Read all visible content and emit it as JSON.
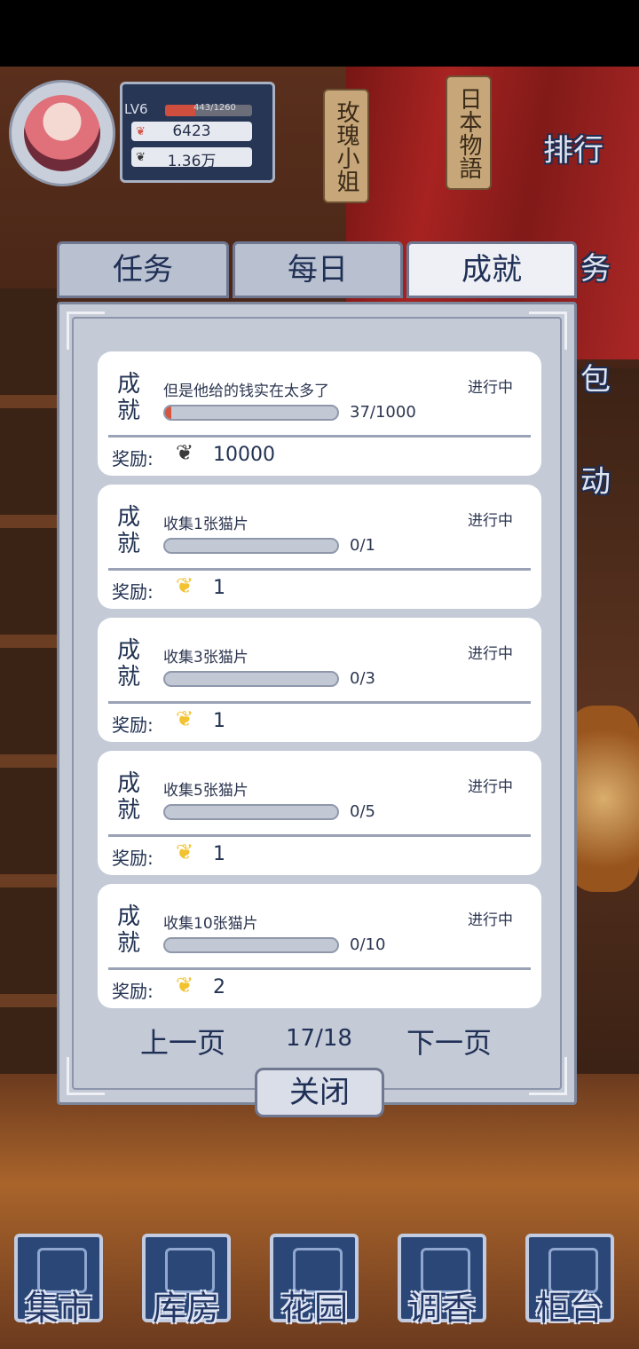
{
  "player": {
    "level": "LV6",
    "xp_text": "443/1260",
    "xp_fraction": 0.35,
    "currency1": "6423",
    "currency2": "1.36万"
  },
  "scene_tags": [
    "玫瑰小姐",
    "日本物語"
  ],
  "side_menu": [
    "排行",
    "务",
    "包",
    "动"
  ],
  "tabs": [
    {
      "label": "任务",
      "active": false
    },
    {
      "label": "每日",
      "active": false
    },
    {
      "label": "成就",
      "active": true
    }
  ],
  "achievements": [
    {
      "type": "成就",
      "title": "但是他给的钱实在太多了",
      "status": "进行中",
      "progress_text": "37/1000",
      "progress": 0.037,
      "reward_label": "奖励:",
      "reward_icon": "gray-leaf-icon",
      "reward_value": "10000"
    },
    {
      "type": "成就",
      "title": "收集1张猫片",
      "status": "进行中",
      "progress_text": "0/1",
      "progress": 0,
      "reward_label": "奖励:",
      "reward_icon": "gold-leaf-icon",
      "reward_value": "1"
    },
    {
      "type": "成就",
      "title": "收集3张猫片",
      "status": "进行中",
      "progress_text": "0/3",
      "progress": 0,
      "reward_label": "奖励:",
      "reward_icon": "gold-leaf-icon",
      "reward_value": "1"
    },
    {
      "type": "成就",
      "title": "收集5张猫片",
      "status": "进行中",
      "progress_text": "0/5",
      "progress": 0,
      "reward_label": "奖励:",
      "reward_icon": "gold-leaf-icon",
      "reward_value": "1"
    },
    {
      "type": "成就",
      "title": "收集10张猫片",
      "status": "进行中",
      "progress_text": "0/10",
      "progress": 0,
      "reward_label": "奖励:",
      "reward_icon": "gold-leaf-icon",
      "reward_value": "2"
    }
  ],
  "pager": {
    "prev": "上一页",
    "page": "17/18",
    "next": "下一页"
  },
  "close_label": "关闭",
  "bottom_nav": [
    "集市",
    "库房",
    "花园",
    "调香",
    "柜台"
  ]
}
